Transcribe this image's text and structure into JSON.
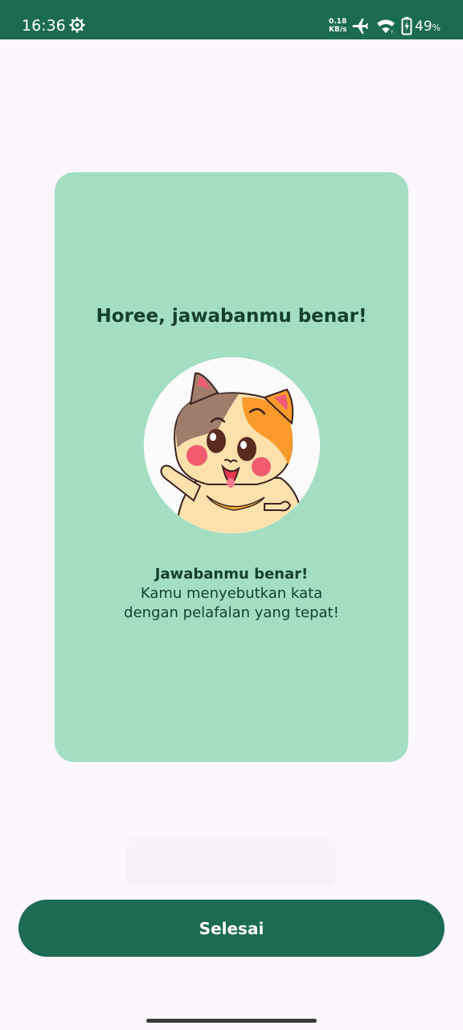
{
  "status_bar": {
    "time": "16:36",
    "net_speed_value": "0.18",
    "net_speed_unit": "KB/s",
    "battery_value": "49",
    "battery_unit": "%",
    "icons": [
      "gear-icon",
      "airplane-icon",
      "wifi-icon",
      "battery-icon"
    ]
  },
  "card": {
    "title": "Horee, jawabanmu benar!",
    "image": "happy-cat-illustration",
    "message_strong": "Jawabanmu benar!",
    "message_line_1": "Kamu menyebutkan kata",
    "message_line_2": "dengan pelafalan yang tepat!"
  },
  "actions": {
    "finish_label": "Selesai"
  },
  "colors": {
    "status_bar": "#1b6b52",
    "background": "#fcf6fd",
    "card": "#a3dec3",
    "text_dark": "#163f2c",
    "button": "#1d6b53"
  }
}
